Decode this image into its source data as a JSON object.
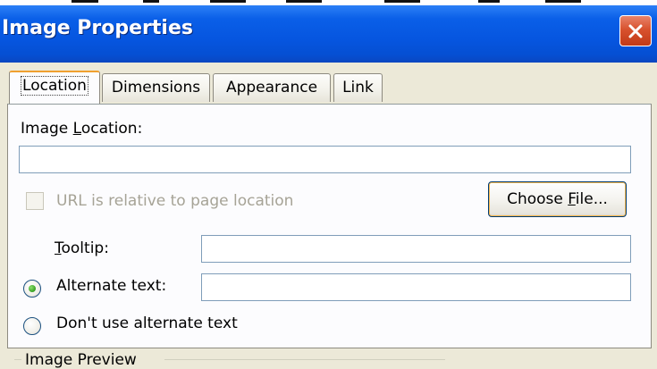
{
  "window": {
    "title": "Image Properties",
    "close_icon": "close-icon"
  },
  "tabs": [
    {
      "label": "Location",
      "active": true
    },
    {
      "label": "Dimensions",
      "active": false
    },
    {
      "label": "Appearance",
      "active": false
    },
    {
      "label": "Link",
      "active": false
    }
  ],
  "location": {
    "image_location_label_pre": "Image ",
    "image_location_label_key": "L",
    "image_location_label_post": "ocation:",
    "image_location_value": "",
    "relative_checkbox_label": "URL is relative to page location",
    "relative_checkbox_checked": false,
    "relative_checkbox_enabled": false,
    "choose_file_pre": "Choose ",
    "choose_file_key": "F",
    "choose_file_post": "ile...",
    "tooltip_label_key": "T",
    "tooltip_label_post": "ooltip:",
    "tooltip_value": "",
    "alt_text_radio_label": "Alternate text:",
    "alt_text_selected": true,
    "alt_text_value": "",
    "no_alt_radio_label": "Don't use alternate text",
    "image_preview_label": "Image Preview"
  },
  "colors": {
    "titlebar": "#0655df",
    "close_button": "#d8522e",
    "dialog_bg": "#ece9d8",
    "active_tab_highlight": "#f0a030"
  }
}
